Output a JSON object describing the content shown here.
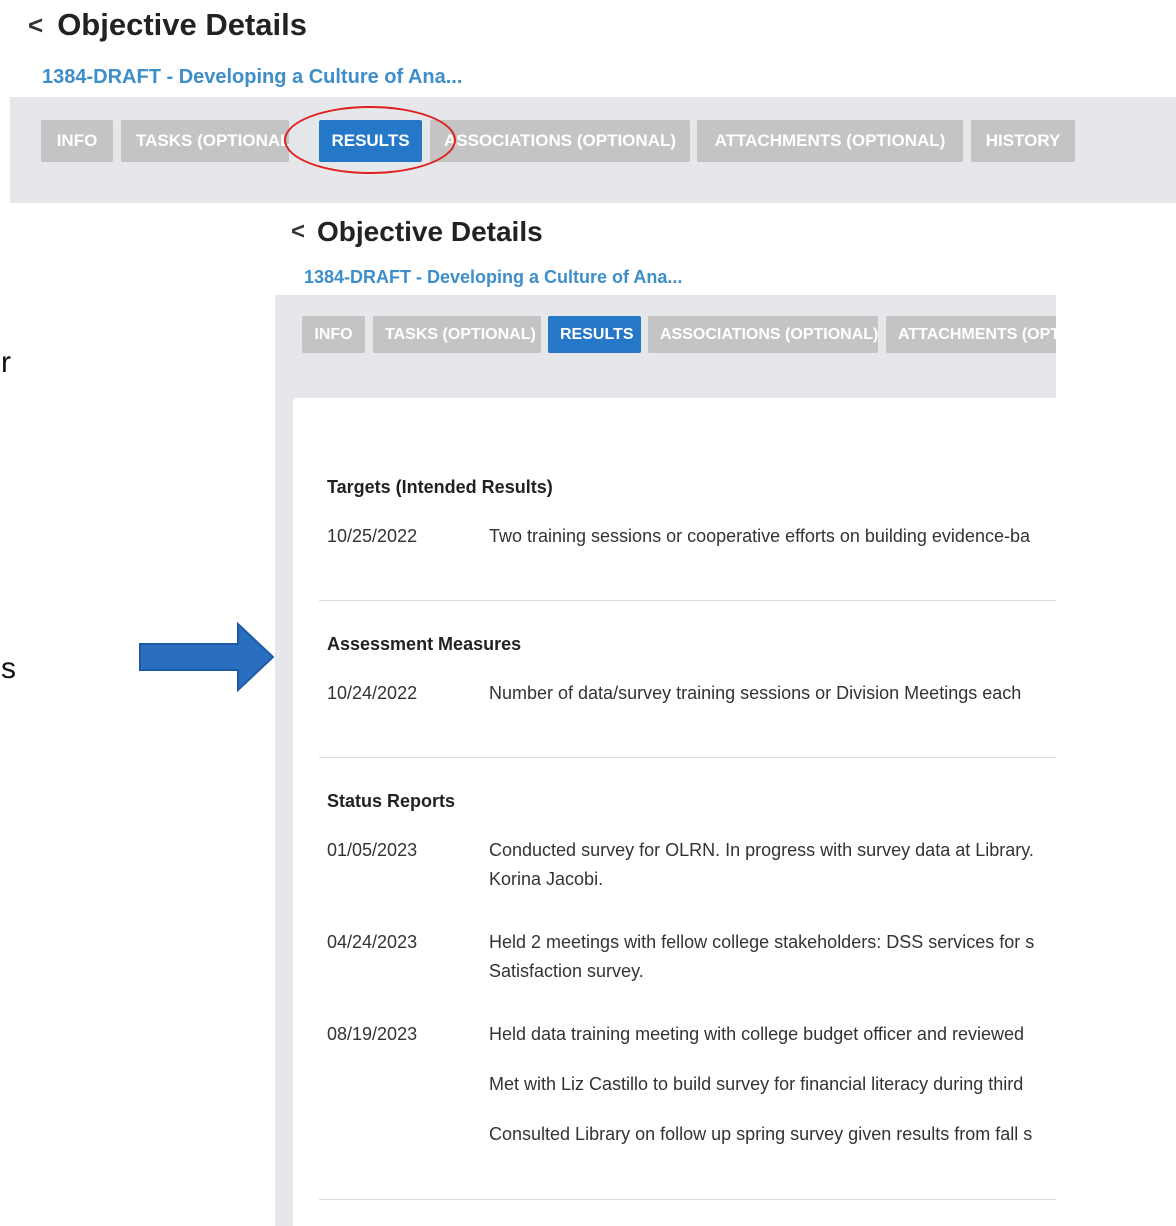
{
  "page": {
    "title": "Objective Details",
    "breadcrumb": "1384-DRAFT - Developing a Culture of Ana...",
    "back_icon": "chevron-left-icon"
  },
  "tabs": [
    {
      "label": "INFO",
      "active": false
    },
    {
      "label": "TASKS (OPTIONAL)",
      "active": false
    },
    {
      "label": "RESULTS",
      "active": true
    },
    {
      "label": "ASSOCIATIONS (OPTIONAL)",
      "active": false
    },
    {
      "label": "ATTACHMENTS (OPTIONAL)",
      "active": false
    },
    {
      "label": "HISTORY",
      "active": false
    }
  ],
  "tabs_cropped": [
    {
      "label": "INFO",
      "active": false
    },
    {
      "label": "TASKS (OPTIONAL)",
      "active": false
    },
    {
      "label": "RESULTS",
      "active": true
    },
    {
      "label": "ASSOCIATIONS (OPTIONAL)",
      "active": false
    },
    {
      "label": "ATTACHMENTS (OPT",
      "active": false
    }
  ],
  "side_text": {
    "letter_1": "r",
    "letter_2": "s"
  },
  "sections": {
    "targets": {
      "title": "Targets (Intended Results)",
      "rows": [
        {
          "date": "10/25/2022",
          "text": "Two training sessions or cooperative efforts on building evidence-ba"
        }
      ]
    },
    "assessment": {
      "title": "Assessment Measures",
      "rows": [
        {
          "date": "10/24/2022",
          "text": "Number of data/survey training sessions or Division Meetings each"
        }
      ]
    },
    "status": {
      "title": "Status Reports",
      "rows": [
        {
          "date": "01/05/2023",
          "text": "Conducted survey for OLRN. In progress with survey data at Library.",
          "text2": "Korina Jacobi."
        },
        {
          "date": "04/24/2023",
          "text": "Held 2 meetings with fellow college stakeholders: DSS services for s",
          "text2": "Satisfaction survey."
        },
        {
          "date": "08/19/2023",
          "text": "Held data training meeting with college budget officer and reviewed",
          "text2": "Met with Liz Castillo to build survey for financial literacy during third",
          "text3": "Consulted Library on follow up spring survey given results from fall s"
        }
      ]
    }
  },
  "colors": {
    "accent": "#2478c7",
    "highlight_ring": "#e0201f",
    "arrow": "#2a6fbf",
    "breadcrumb": "#3e8ec9"
  }
}
